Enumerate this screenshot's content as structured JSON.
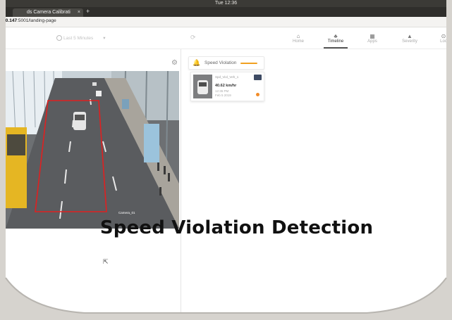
{
  "os": {
    "clock": "Tue 12:36"
  },
  "browser": {
    "tab_title": "ds Camera Calibrati",
    "tab_close": "×",
    "new_tab": "+",
    "url_host": ".0.147",
    "url_path": ":5001/landing-page"
  },
  "app": {
    "time_range": "Last 5 Minutes",
    "nav": [
      {
        "label": "Home",
        "icon": "home-icon"
      },
      {
        "label": "Timeline",
        "icon": "timeline-icon",
        "active": true
      },
      {
        "label": "Apps",
        "icon": "apps-icon"
      },
      {
        "label": "Severity",
        "icon": "severity-icon"
      },
      {
        "label": "Loc",
        "icon": "location-icon"
      }
    ]
  },
  "alert": {
    "title": "Speed Violation",
    "accent": "#f0a020"
  },
  "event": {
    "id": "Spd_Viol_Veh_1",
    "speed": "40.62 km/hr",
    "time": "12:36 PM",
    "date": "Feb 5 2019",
    "dot_color": "#f28c28"
  },
  "camera": {
    "label": "Camera_01"
  },
  "caption": "Speed Violation Detection"
}
